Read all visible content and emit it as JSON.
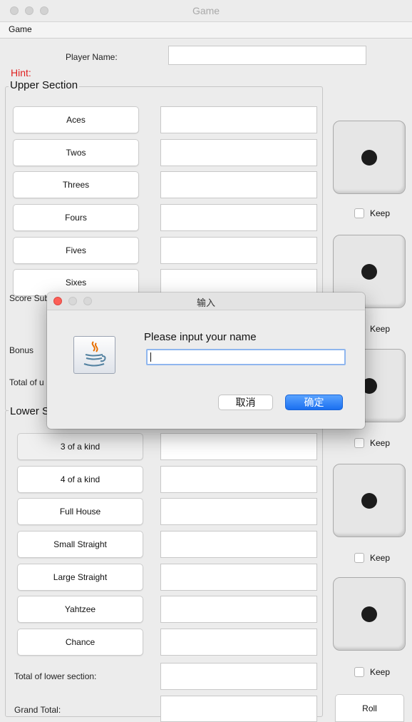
{
  "window": {
    "title": "Game"
  },
  "menubar": {
    "game": "Game"
  },
  "player": {
    "label": "Player Name:",
    "value": ""
  },
  "hint": {
    "label": "Hint:",
    "color": "#e0201e"
  },
  "upper": {
    "title": "Upper Section",
    "buttons": [
      "Aces",
      "Twos",
      "Threes",
      "Fours",
      "Fives",
      "Sixes"
    ],
    "subtotal_label": "Score Sub",
    "bonus_label": "Bonus",
    "total_label": "Total of u"
  },
  "lower": {
    "title": "Lower S",
    "buttons": [
      "3 of a kind",
      "4 of a kind",
      "Full House",
      "Small Straight",
      "Large Straight",
      "Yahtzee",
      "Chance"
    ],
    "total_label": "Total of lower section:",
    "grand_label": "Grand Total:"
  },
  "dice": {
    "keep_label": "Keep",
    "faces": [
      1,
      1,
      1,
      1,
      1
    ]
  },
  "roll": {
    "label": "Roll"
  },
  "dialog": {
    "title": "输入",
    "prompt": "Please input your name",
    "input_value": "",
    "cancel": "取消",
    "ok": "确定",
    "icon": "java-icon",
    "accent": "#1a6ff0"
  }
}
